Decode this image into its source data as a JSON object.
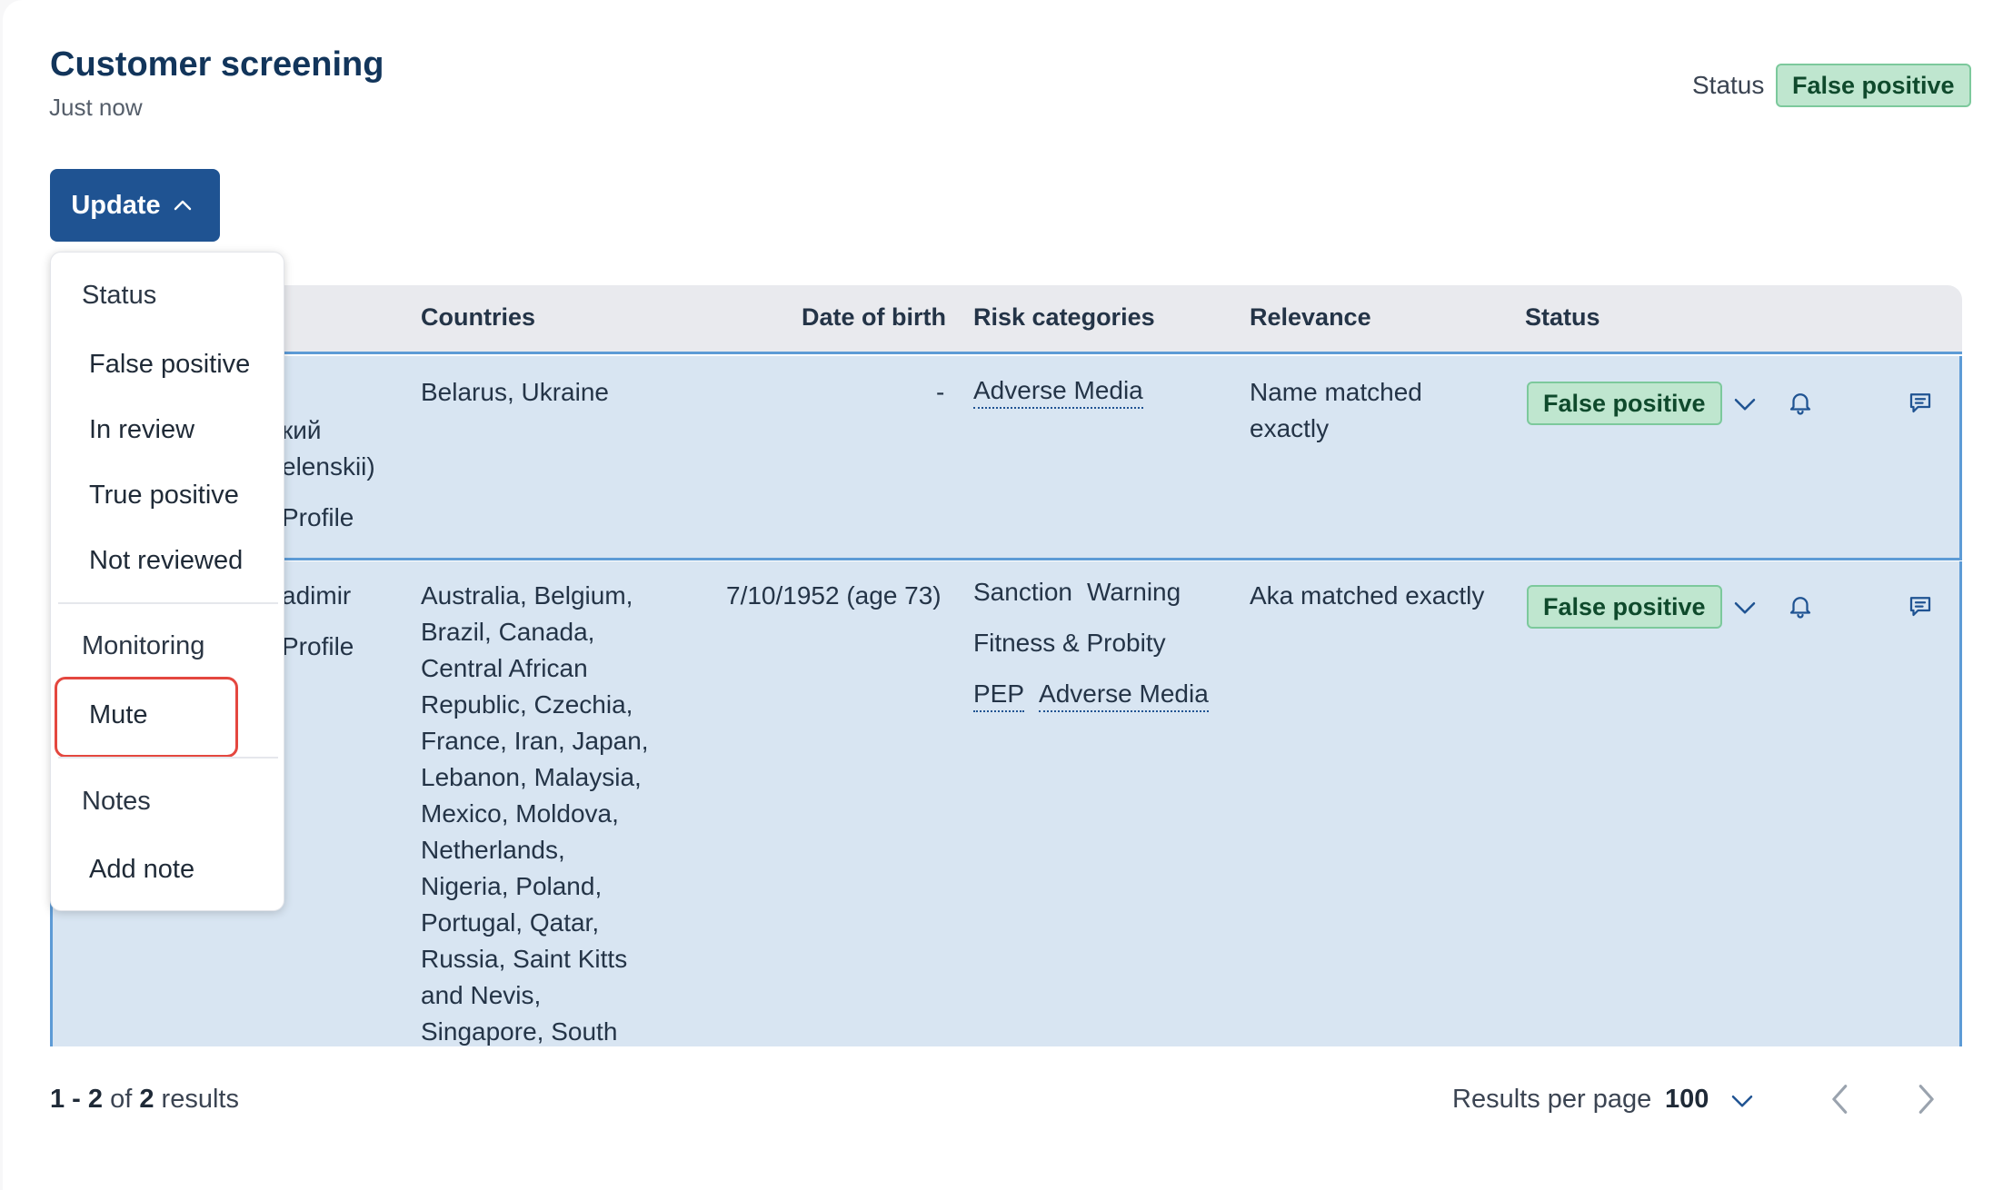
{
  "header": {
    "title": "Customer screening",
    "subtitle": "Just now",
    "status_label": "Status",
    "status_value": "False positive"
  },
  "update_button": {
    "label": "Update",
    "icon": "chevron-up-icon"
  },
  "menu": {
    "status_section": "Status",
    "status_items": [
      "False positive",
      "In review",
      "True positive",
      "Not reviewed"
    ],
    "monitoring_section": "Monitoring",
    "monitoring_items": [
      "Mute"
    ],
    "notes_section": "Notes",
    "notes_items": [
      "Add note"
    ],
    "highlight_color": "#e4473f"
  },
  "table": {
    "columns": [
      "Countries",
      "Date of birth",
      "Risk categories",
      "Relevance",
      "Status"
    ],
    "rows": [
      {
        "name_fragments": [
          "кий",
          "elenskii)",
          "Profile"
        ],
        "countries": "Belarus, Ukraine",
        "dob": "-",
        "risk_categories": [
          "Adverse Media"
        ],
        "relevance_lines": [
          "Name matched",
          "exactly"
        ],
        "status": "False positive"
      },
      {
        "name_fragments": [
          "adimir",
          "Profile"
        ],
        "countries_lines": [
          "Australia, Belgium,",
          "Brazil, Canada,",
          "Central African",
          "Republic, Czechia,",
          "France, Iran, Japan,",
          "Lebanon, Malaysia,",
          "Mexico, Moldova,",
          "Netherlands,",
          "Nigeria, Poland,",
          "Portugal, Qatar,",
          "Russia, Saint Kitts",
          "and Nevis,",
          "Singapore, South"
        ],
        "dob": "7/10/1952 (age 73)",
        "risk_categories": [
          "Sanction",
          "Warning",
          "Fitness & Probity",
          "PEP",
          "Adverse Media"
        ],
        "relevance": "Aka matched exactly",
        "status": "False positive"
      }
    ]
  },
  "footer": {
    "range": "1 - 2",
    "of": "of",
    "total": "2",
    "results": "results",
    "rpp_label": "Results per page",
    "rpp_value": "100"
  },
  "colors": {
    "primary": "#1f5392",
    "badge_bg": "#bfe6cf",
    "row_bg": "#d8e5f2",
    "row_border": "#5d9bd6"
  }
}
